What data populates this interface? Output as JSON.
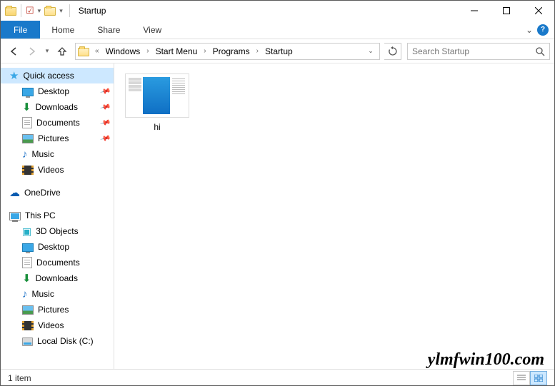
{
  "title": "Startup",
  "ribbon": {
    "file": "File",
    "tabs": [
      "Home",
      "Share",
      "View"
    ]
  },
  "breadcrumbs": [
    "Windows",
    "Start Menu",
    "Programs",
    "Startup"
  ],
  "search_placeholder": "Search Startup",
  "sidebar": {
    "quick_access": {
      "label": "Quick access",
      "items": [
        {
          "label": "Desktop",
          "icon": "desktop",
          "pinned": true
        },
        {
          "label": "Downloads",
          "icon": "download",
          "pinned": true
        },
        {
          "label": "Documents",
          "icon": "doc",
          "pinned": true
        },
        {
          "label": "Pictures",
          "icon": "pic",
          "pinned": true
        },
        {
          "label": "Music",
          "icon": "music",
          "pinned": false
        },
        {
          "label": "Videos",
          "icon": "video",
          "pinned": false
        }
      ]
    },
    "onedrive": {
      "label": "OneDrive"
    },
    "this_pc": {
      "label": "This PC",
      "items": [
        {
          "label": "3D Objects",
          "icon": "3d"
        },
        {
          "label": "Desktop",
          "icon": "desktop"
        },
        {
          "label": "Documents",
          "icon": "doc"
        },
        {
          "label": "Downloads",
          "icon": "download"
        },
        {
          "label": "Music",
          "icon": "music"
        },
        {
          "label": "Pictures",
          "icon": "pic"
        },
        {
          "label": "Videos",
          "icon": "video"
        },
        {
          "label": "Local Disk (C:)",
          "icon": "disk"
        }
      ]
    }
  },
  "content": {
    "items": [
      {
        "label": "hi",
        "type": "program-thumb"
      }
    ]
  },
  "status": "1 item",
  "watermark": "ylmfwin100.com"
}
